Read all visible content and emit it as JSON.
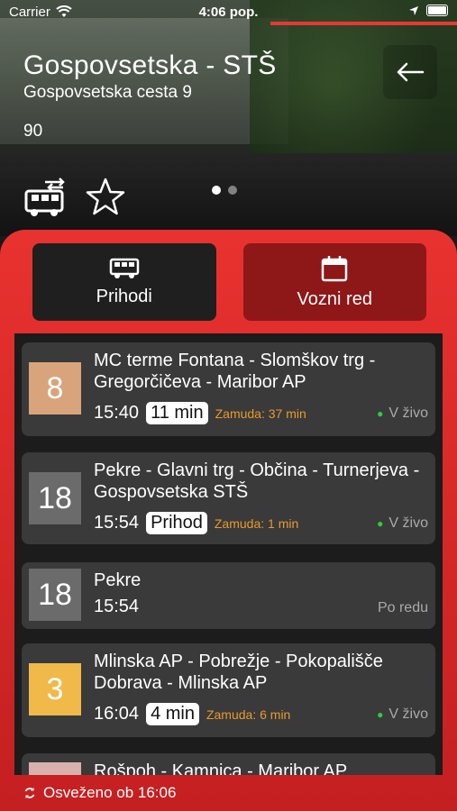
{
  "status_bar": {
    "carrier": "Carrier",
    "time": "4:06 pop."
  },
  "stop": {
    "name": "Gospovsetska - STŠ",
    "address": "Gospovsetska cesta 9",
    "number": "90"
  },
  "tabs": [
    {
      "label": "Prihodi",
      "icon": "bus-icon",
      "active": true
    },
    {
      "label": "Vozni red",
      "icon": "calendar-icon",
      "active": false
    }
  ],
  "arrivals": [
    {
      "line": "8",
      "badge_color": "#d9a47c",
      "route": "MC terme Fontana - Slomškov trg - Gregorčičeva - Maribor AP",
      "time": "15:40",
      "pill": "11 min",
      "delay": "Zamuda: 37 min",
      "live": "V živo"
    },
    {
      "line": "18",
      "badge_color": "#6b6b6b",
      "route": "Pekre - Glavni trg - Občina - Turnerjeva - Gospovsetska STŠ",
      "time": "15:54",
      "pill": "Prihod",
      "delay": "Zamuda: 1 min",
      "live": "V živo"
    },
    {
      "line": "18",
      "badge_color": "#6b6b6b",
      "route": "Pekre",
      "time": "15:54",
      "status": "Po redu"
    },
    {
      "line": "3",
      "badge_color": "#f0b94a",
      "route": "Mlinska AP - Pobrežje - Pokopališče Dobrava - Mlinska AP",
      "time": "16:04",
      "pill": "4 min",
      "delay": "Zamuda: 6 min",
      "live": "V živo"
    },
    {
      "line": "",
      "badge_color": "#d9b1ac",
      "route": "Rošpoh - Kamnica - Maribor AP"
    }
  ],
  "footer": {
    "refreshed": "Osveženo ob 16:06"
  }
}
